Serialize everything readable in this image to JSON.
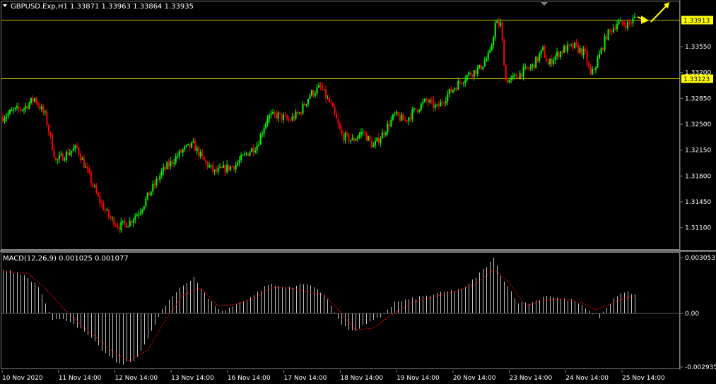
{
  "header": {
    "symbol_line": "GBPUSD.Exp,H1  1.33871 1.33963 1.33864 1.33935",
    "menu_icon": "triangle-down-icon"
  },
  "macd": {
    "label": "MACD(12,26,9) 0.001025 0.001077"
  },
  "colors": {
    "background": "#000000",
    "bull": "#00ff00",
    "bear": "#ff0000",
    "level_line": "#c8c800",
    "level_label_bg": "#ffff00",
    "histogram": "#c0c0c0",
    "signal": "#ff0000",
    "arrow": "#ffff00"
  },
  "chart_data": [
    {
      "type": "candlestick",
      "title": "GBPUSD.Exp,H1",
      "price_axis_ticks": [
        "1.33550",
        "1.33200",
        "1.32850",
        "1.32500",
        "1.32150",
        "1.31800",
        "1.31450",
        "1.31100"
      ],
      "ylim": [
        1.3082,
        1.34152
      ],
      "levels": [
        {
          "label": "1.33913",
          "value": 1.33913
        },
        {
          "label": "1.33123",
          "value": 1.33123
        }
      ],
      "time_axis_labels": [
        "10 Nov 2020",
        "11 Nov 14:00",
        "12 Nov 14:00",
        "13 Nov 14:00",
        "16 Nov 14:00",
        "17 Nov 14:00",
        "18 Nov 14:00",
        "19 Nov 14:00",
        "20 Nov 14:00",
        "23 Nov 14:00",
        "24 Nov 14:00",
        "25 Nov 14:00"
      ],
      "anchors": [
        [
          0,
          1.326
        ],
        [
          6,
          1.3268
        ],
        [
          12,
          1.3272
        ],
        [
          18,
          1.3285
        ],
        [
          24,
          1.3262
        ],
        [
          30,
          1.32
        ],
        [
          36,
          1.321
        ],
        [
          42,
          1.3218
        ],
        [
          48,
          1.3185
        ],
        [
          54,
          1.315
        ],
        [
          60,
          1.3125
        ],
        [
          66,
          1.3112
        ],
        [
          72,
          1.3118
        ],
        [
          78,
          1.3135
        ],
        [
          84,
          1.316
        ],
        [
          90,
          1.3185
        ],
        [
          96,
          1.32
        ],
        [
          102,
          1.3215
        ],
        [
          108,
          1.3222
        ],
        [
          114,
          1.32
        ],
        [
          120,
          1.3185
        ],
        [
          126,
          1.319
        ],
        [
          132,
          1.3195
        ],
        [
          138,
          1.321
        ],
        [
          144,
          1.3222
        ],
        [
          150,
          1.326
        ],
        [
          156,
          1.3262
        ],
        [
          162,
          1.3255
        ],
        [
          168,
          1.3265
        ],
        [
          174,
          1.329
        ],
        [
          180,
          1.33
        ],
        [
          186,
          1.3275
        ],
        [
          192,
          1.3235
        ],
        [
          198,
          1.3228
        ],
        [
          204,
          1.324
        ],
        [
          210,
          1.322
        ],
        [
          216,
          1.324
        ],
        [
          222,
          1.3262
        ],
        [
          228,
          1.3255
        ],
        [
          234,
          1.327
        ],
        [
          240,
          1.3282
        ],
        [
          246,
          1.3272
        ],
        [
          252,
          1.329
        ],
        [
          258,
          1.3305
        ],
        [
          264,
          1.3318
        ],
        [
          270,
          1.3325
        ],
        [
          276,
          1.3345
        ],
        [
          279,
          1.3385
        ],
        [
          282,
          1.3385
        ],
        [
          285,
          1.331
        ],
        [
          288,
          1.331
        ],
        [
          294,
          1.332
        ],
        [
          300,
          1.3328
        ],
        [
          306,
          1.335
        ],
        [
          309,
          1.333
        ],
        [
          312,
          1.334
        ],
        [
          318,
          1.3352
        ],
        [
          324,
          1.3355
        ],
        [
          330,
          1.3345
        ],
        [
          333,
          1.3315
        ],
        [
          336,
          1.333
        ],
        [
          342,
          1.337
        ],
        [
          348,
          1.3387
        ],
        [
          354,
          1.3385
        ],
        [
          358,
          1.3393
        ]
      ],
      "note_arrow": "projection arrows at right edge"
    },
    {
      "type": "histogram",
      "title": "MACD(12,26,9) 0.001025 0.001077",
      "value_axis_ticks": [
        "0.003053",
        "0.00",
        "-0.002935"
      ],
      "ylim": [
        -0.002935,
        0.003053
      ],
      "series": [
        {
          "name": "MACD",
          "anchors": [
            [
              0,
              0.0024
            ],
            [
              12,
              0.0021
            ],
            [
              20,
              0.0015
            ],
            [
              28,
              -0.0003
            ],
            [
              38,
              -0.0004
            ],
            [
              48,
              -0.0012
            ],
            [
              58,
              -0.0022
            ],
            [
              66,
              -0.0028
            ],
            [
              74,
              -0.0026
            ],
            [
              82,
              -0.0014
            ],
            [
              90,
              0.0002
            ],
            [
              100,
              0.0014
            ],
            [
              108,
              0.002
            ],
            [
              116,
              0.0008
            ],
            [
              124,
              0.0001
            ],
            [
              134,
              0.0006
            ],
            [
              142,
              0.001
            ],
            [
              150,
              0.0016
            ],
            [
              160,
              0.0014
            ],
            [
              170,
              0.0016
            ],
            [
              176,
              0.0015
            ],
            [
              184,
              0.0008
            ],
            [
              192,
              -0.0006
            ],
            [
              198,
              -0.001
            ],
            [
              206,
              -0.0006
            ],
            [
              214,
              -0.0002
            ],
            [
              222,
              0.0006
            ],
            [
              232,
              0.0008
            ],
            [
              242,
              0.001
            ],
            [
              252,
              0.0012
            ],
            [
              262,
              0.0014
            ],
            [
              272,
              0.0024
            ],
            [
              278,
              0.003
            ],
            [
              284,
              0.0018
            ],
            [
              292,
              0.0006
            ],
            [
              300,
              0.0006
            ],
            [
              308,
              0.001
            ],
            [
              316,
              0.0008
            ],
            [
              324,
              0.0007
            ],
            [
              332,
              0.0001
            ],
            [
              338,
              -0.0002
            ],
            [
              346,
              0.0008
            ],
            [
              352,
              0.0012
            ],
            [
              358,
              0.001
            ]
          ]
        },
        {
          "name": "Signal",
          "anchors": [
            [
              0,
              0.0023
            ],
            [
              14,
              0.0022
            ],
            [
              24,
              0.0014
            ],
            [
              34,
              0.0003
            ],
            [
              44,
              -0.0006
            ],
            [
              54,
              -0.0014
            ],
            [
              64,
              -0.0022
            ],
            [
              72,
              -0.0026
            ],
            [
              82,
              -0.002
            ],
            [
              92,
              -0.0004
            ],
            [
              102,
              0.001
            ],
            [
              112,
              0.0014
            ],
            [
              122,
              0.0004
            ],
            [
              132,
              0.0005
            ],
            [
              142,
              0.0008
            ],
            [
              152,
              0.0014
            ],
            [
              162,
              0.0014
            ],
            [
              172,
              0.0012
            ],
            [
              182,
              0.001
            ],
            [
              192,
              0.0
            ],
            [
              200,
              -0.0009
            ],
            [
              210,
              -0.0008
            ],
            [
              220,
              -0.0001
            ],
            [
              232,
              0.0006
            ],
            [
              244,
              0.0009
            ],
            [
              256,
              0.0012
            ],
            [
              268,
              0.0016
            ],
            [
              278,
              0.0024
            ],
            [
              286,
              0.0018
            ],
            [
              296,
              0.0004
            ],
            [
              306,
              0.0007
            ],
            [
              318,
              0.0008
            ],
            [
              328,
              0.0006
            ],
            [
              336,
              0.0002
            ],
            [
              346,
              0.0006
            ],
            [
              358,
              0.001
            ]
          ]
        }
      ]
    }
  ]
}
